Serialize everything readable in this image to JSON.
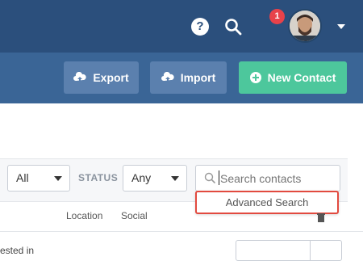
{
  "header": {
    "help_icon": "question-circle-icon",
    "search_icon": "search-icon",
    "notification_count": "1",
    "avatar_icon": "user-avatar",
    "menu_icon": "chevron-down-icon"
  },
  "actions": {
    "export_label": "Export",
    "import_label": "Import",
    "new_contact_label": "New Contact"
  },
  "filters": {
    "first_select_value": "All",
    "status_label": "STATUS",
    "status_select_value": "Any",
    "search_placeholder": "Search contacts",
    "advanced_search_label": "Advanced Search"
  },
  "table": {
    "columns": [
      "Location",
      "Social"
    ],
    "partial_row_text": "ested in"
  },
  "colors": {
    "topbar": "#2b4f7c",
    "subbar": "#3a6596",
    "secondary_button": "#5b80ae",
    "primary_button": "#4dc79c",
    "highlight": "#e24a3f",
    "badge": "#e8424a"
  }
}
